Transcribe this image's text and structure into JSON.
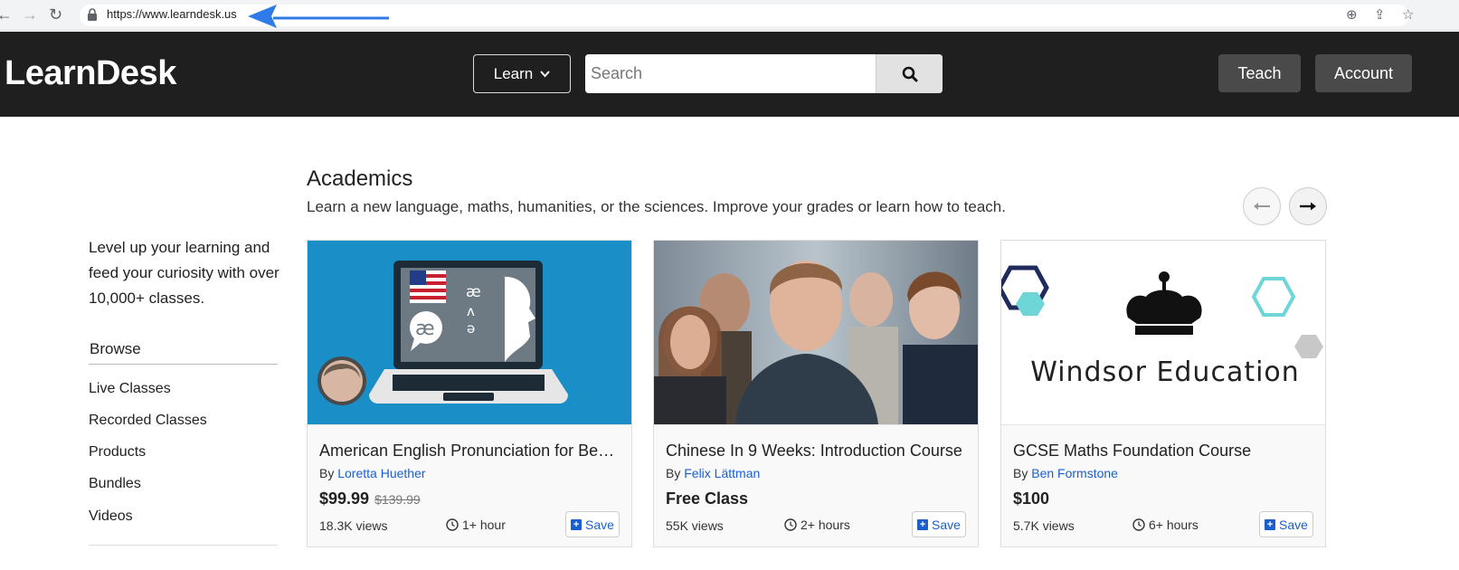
{
  "browser": {
    "url": "https://www.learndesk.us"
  },
  "header": {
    "logo": "LearnDesk",
    "learn_label": "Learn",
    "search_placeholder": "Search",
    "teach_label": "Teach",
    "account_label": "Account"
  },
  "sidebar": {
    "tagline": "Level up your learning and feed your curiosity with over 10,000+ classes.",
    "browse_title": "Browse",
    "items": [
      {
        "label": "Live Classes"
      },
      {
        "label": "Recorded Classes"
      },
      {
        "label": "Products"
      },
      {
        "label": "Bundles"
      },
      {
        "label": "Videos"
      }
    ]
  },
  "section": {
    "title": "Academics",
    "description": "Learn a new language, maths, humanities, or the sciences. Improve your grades or learn how to teach."
  },
  "cards": [
    {
      "title": "American English Pronunciation for Beginners",
      "by": "By",
      "author": "Loretta Huether",
      "price": "$99.99",
      "old_price": "$139.99",
      "views": "18.3K views",
      "duration": "1+ hour",
      "save_label": "Save"
    },
    {
      "title": "Chinese In 9 Weeks: Introduction Course",
      "by": "By",
      "author": "Felix Lättman",
      "price": "Free Class",
      "old_price": "",
      "views": "55K views",
      "duration": "2+ hours",
      "save_label": "Save"
    },
    {
      "title": "GCSE Maths Foundation Course",
      "by": "By",
      "author": "Ben Formstone",
      "price": "$100",
      "old_price": "",
      "views": "5.7K views",
      "duration": "6+ hours",
      "save_label": "Save",
      "image_text": "Windsor Education"
    }
  ],
  "colors": {
    "header_bg": "#1f1f1f",
    "link": "#1b5fcf",
    "card1_bg": "#1a8fc7",
    "annotation_arrow": "#2f7be8"
  }
}
